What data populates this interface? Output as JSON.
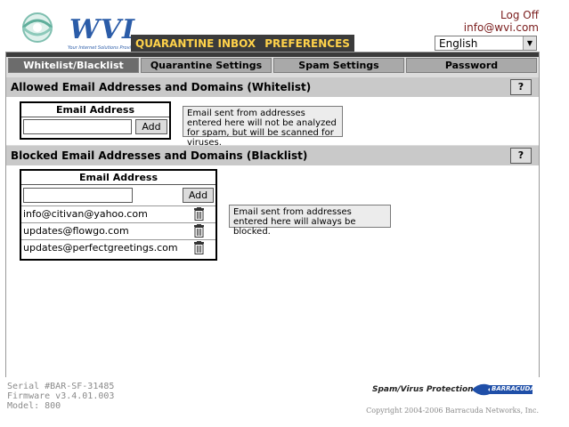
{
  "header": {
    "logo_text": "WVI",
    "logo_tagline": "Your Internet Solutions Provider",
    "logout_label": "Log Off",
    "user_email": "info@wvi.com",
    "nav_tabs": [
      "QUARANTINE INBOX",
      "PREFERENCES"
    ],
    "language_selected": "English"
  },
  "subtabs": [
    "Whitelist/Blacklist",
    "Quarantine Settings",
    "Spam Settings",
    "Password"
  ],
  "whitelist": {
    "title": "Allowed Email Addresses and Domains (Whitelist)",
    "help_label": "?",
    "column_header": "Email Address",
    "add_label": "Add",
    "info_text": "Email sent from addresses entered here will not be analyzed for spam, but will be scanned for viruses."
  },
  "blacklist": {
    "title": "Blocked Email Addresses and Domains (Blacklist)",
    "help_label": "?",
    "column_header": "Email Address",
    "add_label": "Add",
    "info_text": "Email sent from addresses entered here will always be blocked.",
    "entries": [
      "info@citivan@yahoo.com",
      "updates@flowgo.com",
      "updates@perfectgreetings.com"
    ]
  },
  "footer": {
    "serial": "Serial #BAR-SF-31485",
    "firmware": "Firmware v3.4.01.003",
    "model": "Model: 800",
    "protection_label": "Spam/Virus Protection By",
    "brand": "BARRACUDA",
    "copyright": "Copyright 2004-2006 Barracuda Networks, Inc."
  },
  "colors": {
    "nav_bg": "#3b3b3b",
    "nav_active_text": "#ffd24a",
    "logo_blue": "#2b5ca8",
    "link_red": "#7a1c1c"
  }
}
